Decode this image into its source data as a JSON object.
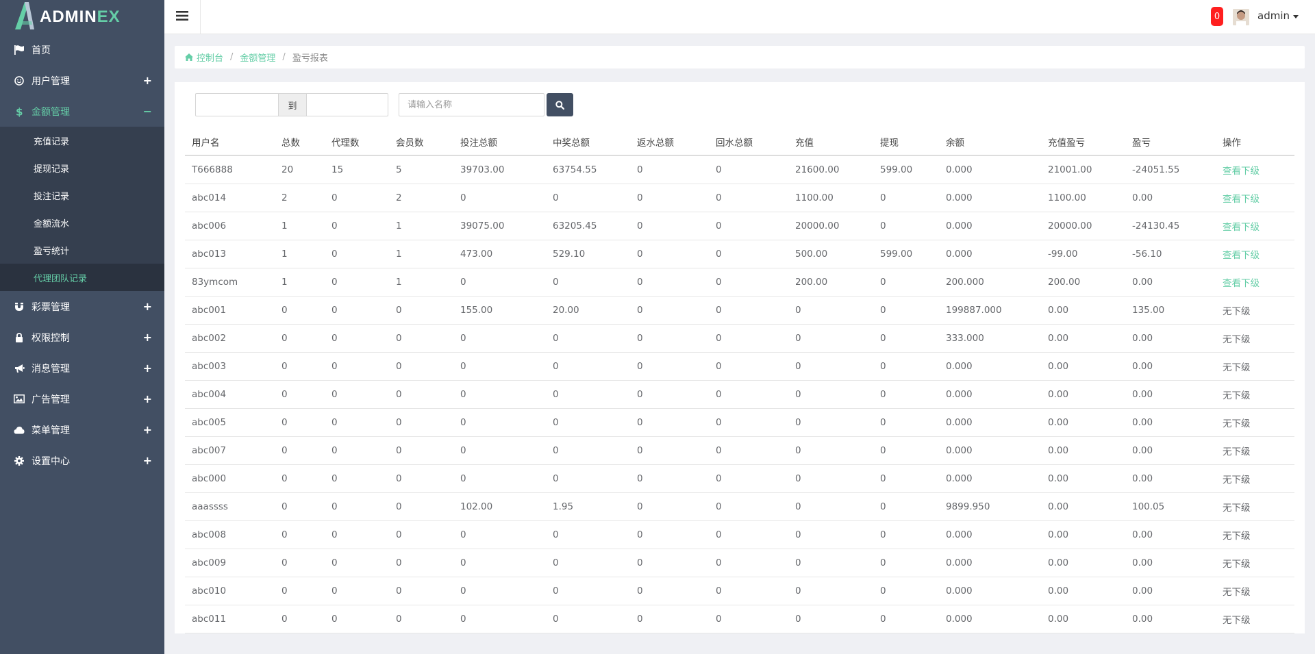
{
  "brand": {
    "name_main": "ADMIN",
    "name_accent": "EX",
    "accent_color": "#65cea7"
  },
  "header": {
    "notification_count": "0",
    "user": "admin"
  },
  "sidebar": {
    "items": [
      {
        "label": "首页",
        "icon": "flag-icon",
        "expandable": false
      },
      {
        "label": "用户管理",
        "icon": "smile-icon",
        "expandable": true,
        "toggle": "+"
      },
      {
        "label": "金额管理",
        "icon": "dollar-icon",
        "expandable": true,
        "toggle": "−",
        "active": true,
        "children": [
          {
            "label": "充值记录"
          },
          {
            "label": "提现记录"
          },
          {
            "label": "投注记录"
          },
          {
            "label": "金额流水"
          },
          {
            "label": "盈亏统计"
          },
          {
            "label": "代理团队记录",
            "active": true
          }
        ]
      },
      {
        "label": "彩票管理",
        "icon": "magnet-icon",
        "expandable": true,
        "toggle": "+"
      },
      {
        "label": "权限控制",
        "icon": "lock-icon",
        "expandable": true,
        "toggle": "+"
      },
      {
        "label": "消息管理",
        "icon": "bullhorn-icon",
        "expandable": true,
        "toggle": "+"
      },
      {
        "label": "广告管理",
        "icon": "picture-icon",
        "expandable": true,
        "toggle": "+"
      },
      {
        "label": "菜单管理",
        "icon": "cloud-icon",
        "expandable": true,
        "toggle": "+"
      },
      {
        "label": "设置中心",
        "icon": "gear-icon",
        "expandable": true,
        "toggle": "+"
      }
    ]
  },
  "breadcrumb": {
    "home": "控制台",
    "section": "金额管理",
    "current": "盈亏报表"
  },
  "filters": {
    "date_from": "",
    "to_label": "到",
    "date_to": "",
    "name_placeholder": "请输入名称",
    "name_value": ""
  },
  "table": {
    "headers": [
      "用户名",
      "总数",
      "代理数",
      "会员数",
      "投注总额",
      "中奖总额",
      "返水总额",
      "回水总额",
      "充值",
      "提现",
      "余额",
      "充值盈亏",
      "盈亏",
      "操作"
    ],
    "rows": [
      [
        "T666888",
        "20",
        "15",
        "5",
        "39703.00",
        "63754.55",
        "0",
        "0",
        "21600.00",
        "599.00",
        "0.000",
        "21001.00",
        "-24051.55",
        "查看下级"
      ],
      [
        "abc014",
        "2",
        "0",
        "2",
        "0",
        "0",
        "0",
        "0",
        "1100.00",
        "0",
        "0.000",
        "1100.00",
        "0.00",
        "查看下级"
      ],
      [
        "abc006",
        "1",
        "0",
        "1",
        "39075.00",
        "63205.45",
        "0",
        "0",
        "20000.00",
        "0",
        "0.000",
        "20000.00",
        "-24130.45",
        "查看下级"
      ],
      [
        "abc013",
        "1",
        "0",
        "1",
        "473.00",
        "529.10",
        "0",
        "0",
        "500.00",
        "599.00",
        "0.000",
        "-99.00",
        "-56.10",
        "查看下级"
      ],
      [
        "83ymcom",
        "1",
        "0",
        "1",
        "0",
        "0",
        "0",
        "0",
        "200.00",
        "0",
        "200.000",
        "200.00",
        "0.00",
        "查看下级"
      ],
      [
        "abc001",
        "0",
        "0",
        "0",
        "155.00",
        "20.00",
        "0",
        "0",
        "0",
        "0",
        "199887.000",
        "0.00",
        "135.00",
        "无下级"
      ],
      [
        "abc002",
        "0",
        "0",
        "0",
        "0",
        "0",
        "0",
        "0",
        "0",
        "0",
        "333.000",
        "0.00",
        "0.00",
        "无下级"
      ],
      [
        "abc003",
        "0",
        "0",
        "0",
        "0",
        "0",
        "0",
        "0",
        "0",
        "0",
        "0.000",
        "0.00",
        "0.00",
        "无下级"
      ],
      [
        "abc004",
        "0",
        "0",
        "0",
        "0",
        "0",
        "0",
        "0",
        "0",
        "0",
        "0.000",
        "0.00",
        "0.00",
        "无下级"
      ],
      [
        "abc005",
        "0",
        "0",
        "0",
        "0",
        "0",
        "0",
        "0",
        "0",
        "0",
        "0.000",
        "0.00",
        "0.00",
        "无下级"
      ],
      [
        "abc007",
        "0",
        "0",
        "0",
        "0",
        "0",
        "0",
        "0",
        "0",
        "0",
        "0.000",
        "0.00",
        "0.00",
        "无下级"
      ],
      [
        "abc000",
        "0",
        "0",
        "0",
        "0",
        "0",
        "0",
        "0",
        "0",
        "0",
        "0.000",
        "0.00",
        "0.00",
        "无下级"
      ],
      [
        "aaassss",
        "0",
        "0",
        "0",
        "102.00",
        "1.95",
        "0",
        "0",
        "0",
        "0",
        "9899.950",
        "0.00",
        "100.05",
        "无下级"
      ],
      [
        "abc008",
        "0",
        "0",
        "0",
        "0",
        "0",
        "0",
        "0",
        "0",
        "0",
        "0.000",
        "0.00",
        "0.00",
        "无下级"
      ],
      [
        "abc009",
        "0",
        "0",
        "0",
        "0",
        "0",
        "0",
        "0",
        "0",
        "0",
        "0.000",
        "0.00",
        "0.00",
        "无下级"
      ],
      [
        "abc010",
        "0",
        "0",
        "0",
        "0",
        "0",
        "0",
        "0",
        "0",
        "0",
        "0.000",
        "0.00",
        "0.00",
        "无下级"
      ],
      [
        "abc011",
        "0",
        "0",
        "0",
        "0",
        "0",
        "0",
        "0",
        "0",
        "0",
        "0.000",
        "0.00",
        "0.00",
        "无下级"
      ]
    ]
  }
}
